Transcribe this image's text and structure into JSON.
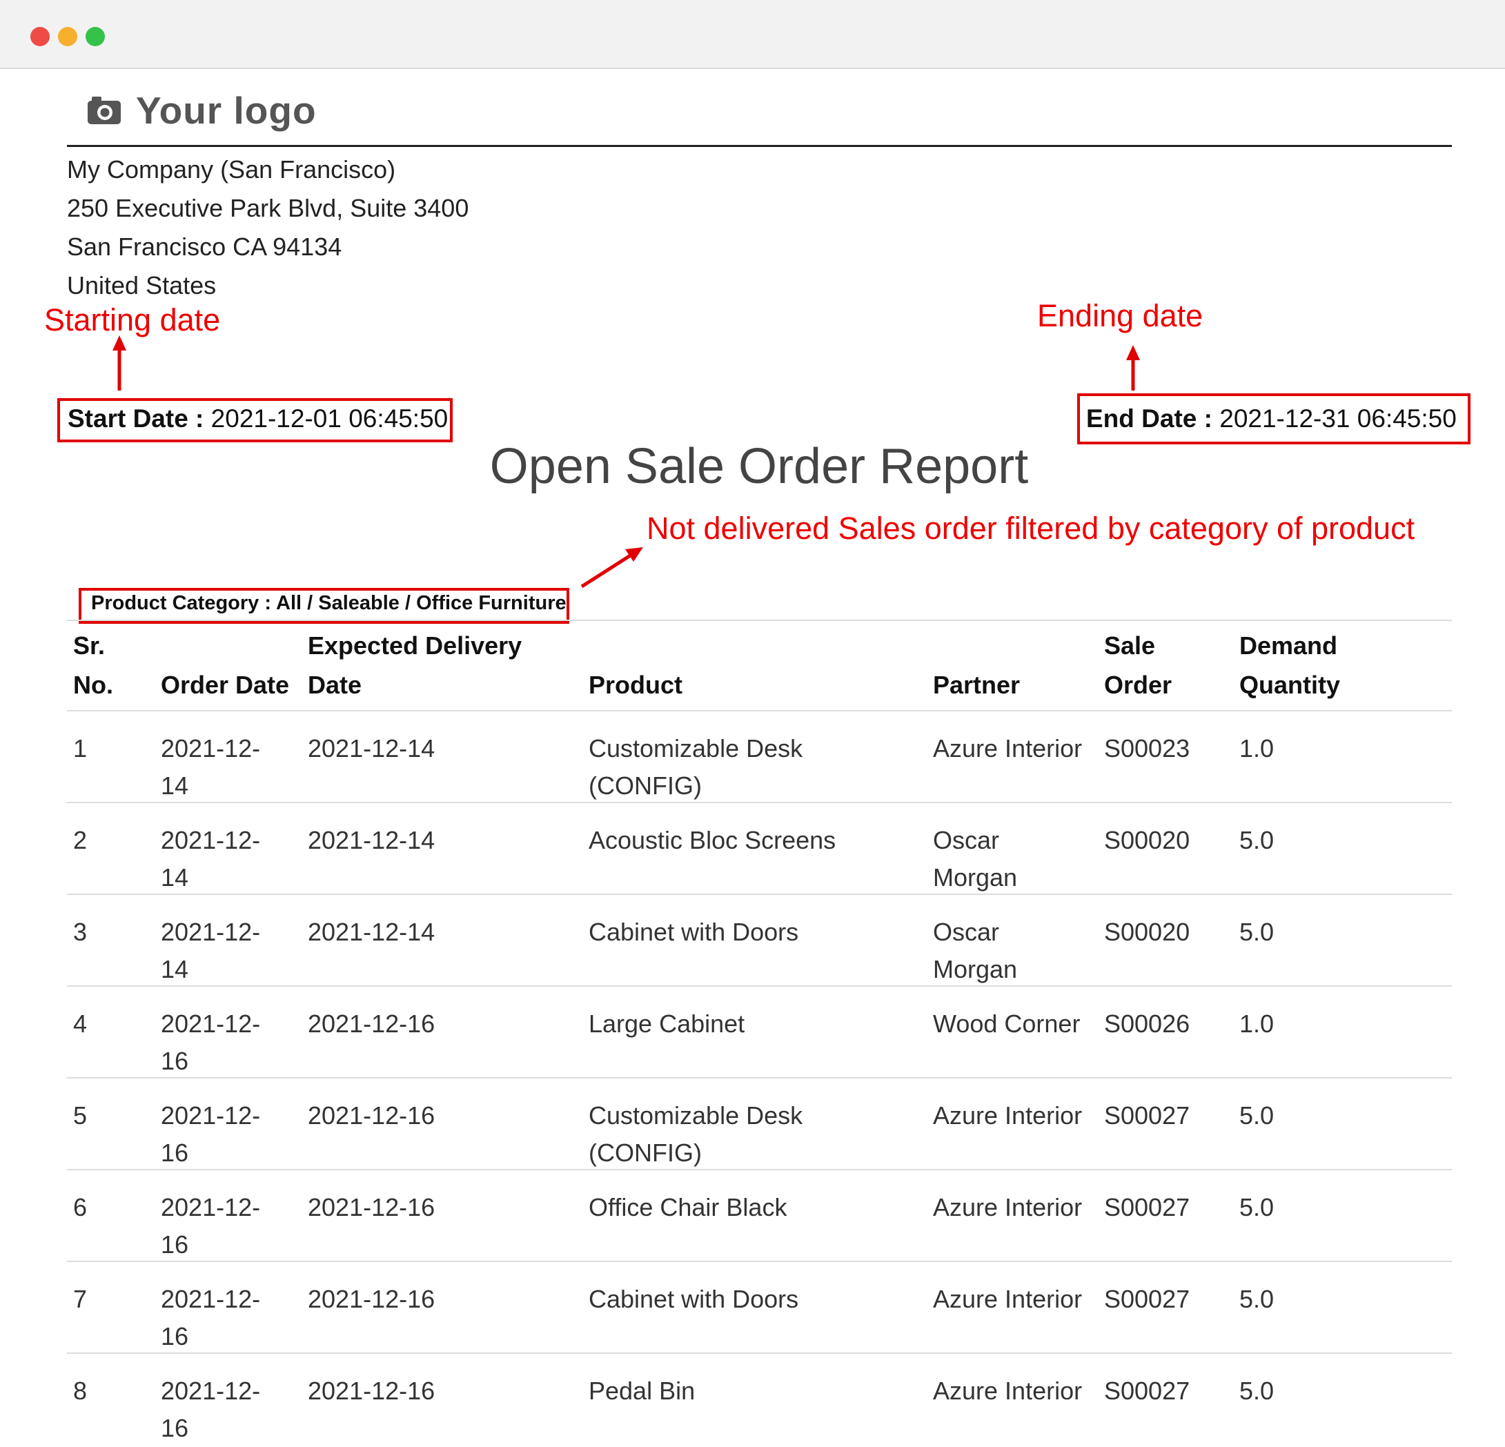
{
  "window": {
    "controls": [
      "close",
      "minimize",
      "maximize"
    ]
  },
  "logo": {
    "text": "Your logo",
    "icon": "camera-icon"
  },
  "company": {
    "name": "My Company (San Francisco)",
    "street": "250 Executive Park Blvd, Suite 3400",
    "city": "San Francisco CA 94134",
    "country": "United States"
  },
  "annotations": {
    "starting": "Starting date",
    "ending": "Ending date",
    "category_note": "Not delivered Sales order filtered by category of product",
    "color": "#ee0000"
  },
  "filters": {
    "start_label": "Start Date :",
    "start_value": "2021-12-01 06:45:50",
    "end_label": "End Date :",
    "end_value": "2021-12-31 06:45:50",
    "category_label": "Product Category :",
    "category_value": "All / Saleable / Office Furniture"
  },
  "report": {
    "title": "Open Sale Order Report"
  },
  "table": {
    "headers": {
      "sr": [
        "Sr.",
        "No."
      ],
      "order_date": [
        "",
        "Order Date"
      ],
      "expected": [
        "Expected Delivery",
        "Date"
      ],
      "product": [
        "",
        "Product"
      ],
      "partner": [
        "",
        "Partner"
      ],
      "sale_order": [
        "Sale",
        "Order"
      ],
      "demand": [
        "Demand",
        "Quantity"
      ]
    },
    "rows": [
      {
        "sr": "1",
        "order_date": [
          "2021-12-",
          "14"
        ],
        "expected": "2021-12-14",
        "product": [
          "Customizable Desk",
          "(CONFIG)"
        ],
        "partner": [
          "Azure Interior",
          ""
        ],
        "sale_order": "S00023",
        "qty": "1.0"
      },
      {
        "sr": "2",
        "order_date": [
          "2021-12-",
          "14"
        ],
        "expected": "2021-12-14",
        "product": [
          "Acoustic Bloc Screens",
          ""
        ],
        "partner": [
          "Oscar",
          "Morgan"
        ],
        "sale_order": "S00020",
        "qty": "5.0"
      },
      {
        "sr": "3",
        "order_date": [
          "2021-12-",
          "14"
        ],
        "expected": "2021-12-14",
        "product": [
          "Cabinet with Doors",
          ""
        ],
        "partner": [
          "Oscar",
          "Morgan"
        ],
        "sale_order": "S00020",
        "qty": "5.0"
      },
      {
        "sr": "4",
        "order_date": [
          "2021-12-",
          "16"
        ],
        "expected": "2021-12-16",
        "product": [
          "Large Cabinet",
          ""
        ],
        "partner": [
          "Wood Corner",
          ""
        ],
        "sale_order": "S00026",
        "qty": "1.0"
      },
      {
        "sr": "5",
        "order_date": [
          "2021-12-",
          "16"
        ],
        "expected": "2021-12-16",
        "product": [
          "Customizable Desk",
          "(CONFIG)"
        ],
        "partner": [
          "Azure Interior",
          ""
        ],
        "sale_order": "S00027",
        "qty": "5.0"
      },
      {
        "sr": "6",
        "order_date": [
          "2021-12-",
          "16"
        ],
        "expected": "2021-12-16",
        "product": [
          "Office Chair Black",
          ""
        ],
        "partner": [
          "Azure Interior",
          ""
        ],
        "sale_order": "S00027",
        "qty": "5.0"
      },
      {
        "sr": "7",
        "order_date": [
          "2021-12-",
          "16"
        ],
        "expected": "2021-12-16",
        "product": [
          "Cabinet with Doors",
          ""
        ],
        "partner": [
          "Azure Interior",
          ""
        ],
        "sale_order": "S00027",
        "qty": "5.0"
      },
      {
        "sr": "8",
        "order_date": [
          "2021-12-",
          "16"
        ],
        "expected": "2021-12-16",
        "product": [
          "Pedal Bin",
          ""
        ],
        "partner": [
          "Azure Interior",
          ""
        ],
        "sale_order": "S00027",
        "qty": "5.0"
      }
    ]
  }
}
